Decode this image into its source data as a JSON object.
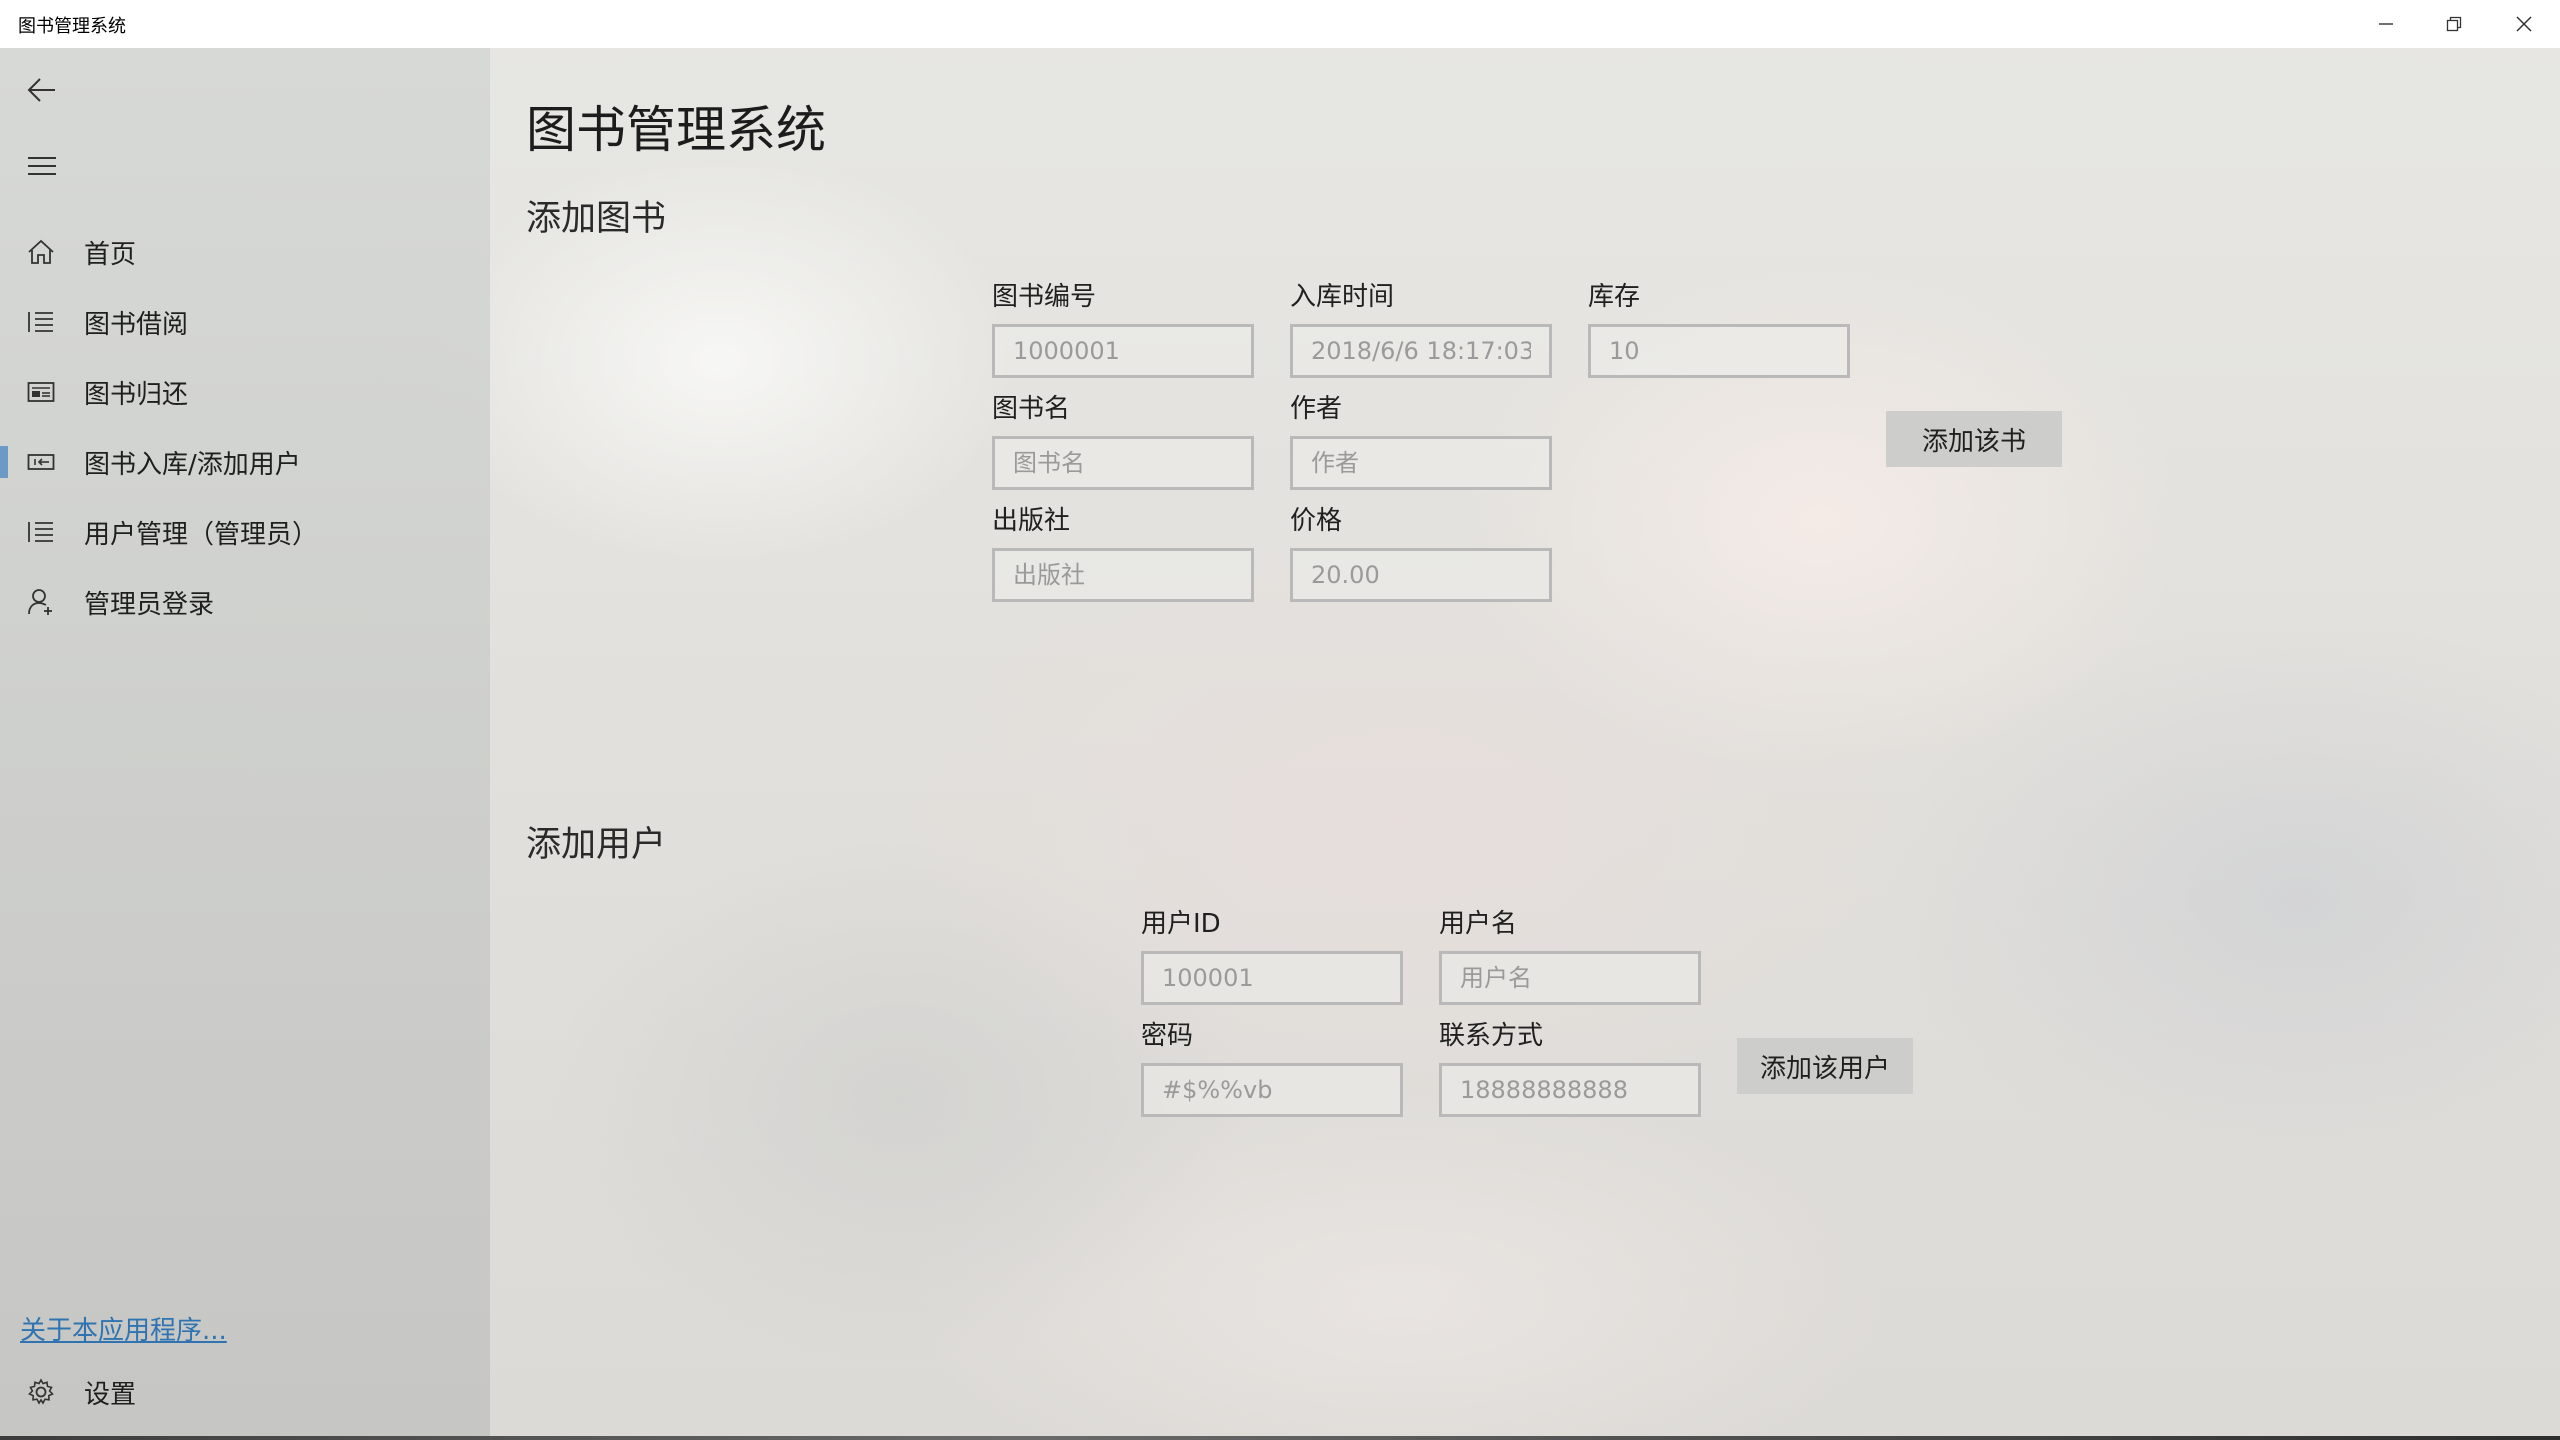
{
  "window": {
    "title": "图书管理系统"
  },
  "nav": {
    "items": [
      {
        "label": "首页",
        "icon": "home-icon"
      },
      {
        "label": "图书借阅",
        "icon": "list-icon"
      },
      {
        "label": "图书归还",
        "icon": "card-icon"
      },
      {
        "label": "图书入库/添加用户",
        "icon": "import-icon",
        "selected": true
      },
      {
        "label": "用户管理（管理员）",
        "icon": "list-icon"
      },
      {
        "label": "管理员登录",
        "icon": "add-user-icon"
      }
    ],
    "about_link": "关于本应用程序...",
    "settings_label": "设置"
  },
  "main": {
    "page_title": "图书管理系统",
    "add_book": {
      "section_title": "添加图书",
      "fields": {
        "book_id": {
          "label": "图书编号",
          "value": "1000001"
        },
        "stock_time": {
          "label": "入库时间",
          "value": "2018/6/6 18:17:03"
        },
        "stock": {
          "label": "库存",
          "value": "10"
        },
        "book_name": {
          "label": "图书名",
          "placeholder": "图书名"
        },
        "author": {
          "label": "作者",
          "placeholder": "作者"
        },
        "publisher": {
          "label": "出版社",
          "placeholder": "出版社"
        },
        "price": {
          "label": "价格",
          "placeholder": "20.00"
        }
      },
      "submit_label": "添加该书"
    },
    "add_user": {
      "section_title": "添加用户",
      "fields": {
        "user_id": {
          "label": "用户ID",
          "value": "100001"
        },
        "username": {
          "label": "用户名",
          "placeholder": "用户名"
        },
        "password": {
          "label": "密码",
          "placeholder": "#$%%vb"
        },
        "contact": {
          "label": "联系方式",
          "placeholder": "18888888888"
        }
      },
      "submit_label": "添加该用户"
    }
  },
  "colors": {
    "selection_indicator": "#6c9ac4",
    "link": "#2f74b0",
    "button_bg": "#cdcdcb",
    "field_border": "#b9b9b9"
  }
}
